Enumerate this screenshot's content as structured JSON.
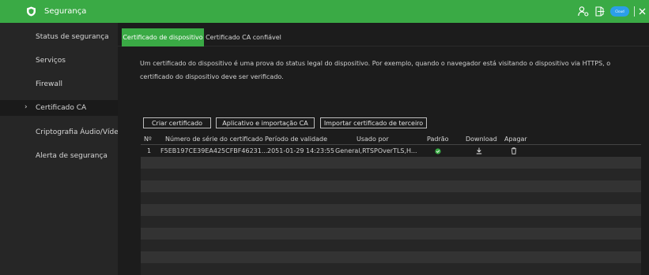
{
  "app": {
    "title": "Segurança",
    "brand_color": "#3aaa45"
  },
  "titlebar_icons": [
    "user-settings-icon",
    "logout-icon",
    "cloud-icon",
    "close-icon"
  ],
  "cloud_badge": "Cloud",
  "sidebar": {
    "items": [
      {
        "label": "Status de segurança",
        "active": false
      },
      {
        "label": "Serviços",
        "active": false
      },
      {
        "label": "Firewall",
        "active": false
      },
      {
        "label": "Certificado CA",
        "active": true
      },
      {
        "label": "Criptografia Áudio/Vídeo",
        "active": false
      },
      {
        "label": "Alerta de segurança",
        "active": false
      }
    ]
  },
  "tabs": [
    {
      "label": "Certificado de dispositivo",
      "active": true
    },
    {
      "label": "Certificado CA confiável",
      "active": false
    }
  ],
  "description": "Um certificado do dispositivo é uma prova do status legal do dispositivo. Por exemplo, quando o navegador está visitando o dispositivo via HTTPS, o certificado do dispositivo deve ser verificado.",
  "buttons": {
    "create": "Criar certificado",
    "app_import": "Aplicativo e importação CA",
    "third_party": "Importar certificado de terceiro"
  },
  "table": {
    "columns": [
      "Nº",
      "Número de série do certificado",
      "Período de validade",
      "Usado por",
      "Padrão",
      "Download",
      "Apagar"
    ],
    "rows": [
      {
        "no": "1",
        "serial": "F5EB197CE39EA425CFBF46231...",
        "validity": "2051-01-29 14:23:55",
        "used_by": "General,RTSPOverTLS,H...",
        "default": true,
        "download_icon": "download-icon",
        "delete_icon": "trash-icon"
      }
    ]
  }
}
